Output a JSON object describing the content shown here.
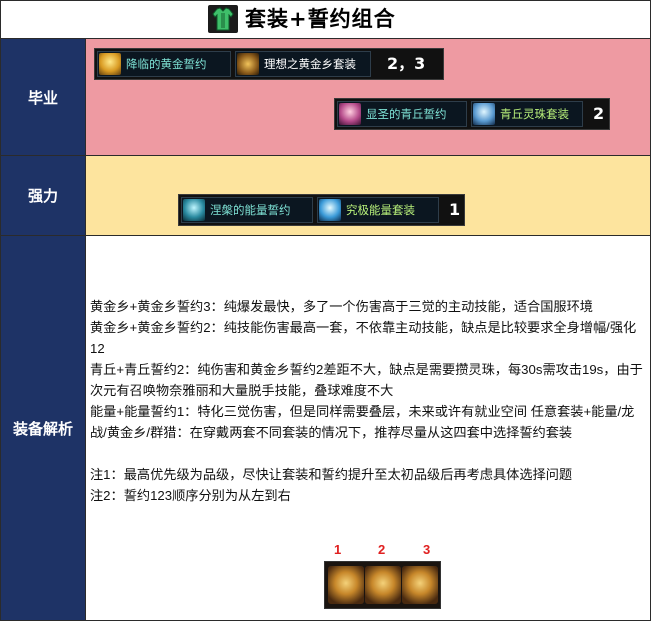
{
  "title": "套装+誓约组合",
  "sections": {
    "bisheng": {
      "label": "毕业",
      "group1": {
        "items": [
          {
            "name": "降临的黄金誓约",
            "color": "#7fe3d6"
          },
          {
            "name": "理想之黄金乡套装",
            "color": "#ffffff"
          }
        ],
        "priority": "2，3"
      },
      "group2": {
        "items": [
          {
            "name": "显圣的青丘誓约",
            "color": "#7fe3d6"
          },
          {
            "name": "青丘灵珠套装",
            "color": "#b8f07a"
          }
        ],
        "priority": "2"
      }
    },
    "qiangli": {
      "label": "强力",
      "group1": {
        "items": [
          {
            "name": "涅槃的能量誓约",
            "color": "#7fe3d6"
          },
          {
            "name": "究极能量套装",
            "color": "#b8f07a"
          }
        ],
        "priority": "1"
      }
    },
    "analysis": {
      "label": "装备解析",
      "lines": [
        "黄金乡+黄金乡誓约3：纯爆发最快，多了一个伤害高于三觉的主动技能，适合国服环境",
        "黄金乡+黄金乡誓约2：纯技能伤害最高一套，不依靠主动技能，缺点是比较要求全身增幅/强化12",
        "青丘+青丘誓约2：纯伤害和黄金乡誓约2差距不大，缺点是需要攒灵珠，每30s需攻击19s，由于次元有召唤物奈雅丽和大量脱手技能，叠球难度不大",
        "能量+能量誓约1：特化三觉伤害，但是同样需要叠层，未来或许有就业空间 任意套装+能量/龙战/黄金乡/群猎：在穿戴两套不同套装的情况下，推荐尽量从这四套中选择誓约套装"
      ],
      "notes": [
        "注1：最高优先级为品级，尽快让套装和誓约提升至太初品级后再考虑具体选择问题",
        "注2：誓约123顺序分别为从左到右"
      ],
      "order_labels": [
        "1",
        "2",
        "3"
      ]
    }
  },
  "colors": {
    "label_bg": "#1e3366",
    "bisheng_bg": "#ee9aa2",
    "qiangli_bg": "#fde49e",
    "accent_red": "#e02020"
  }
}
